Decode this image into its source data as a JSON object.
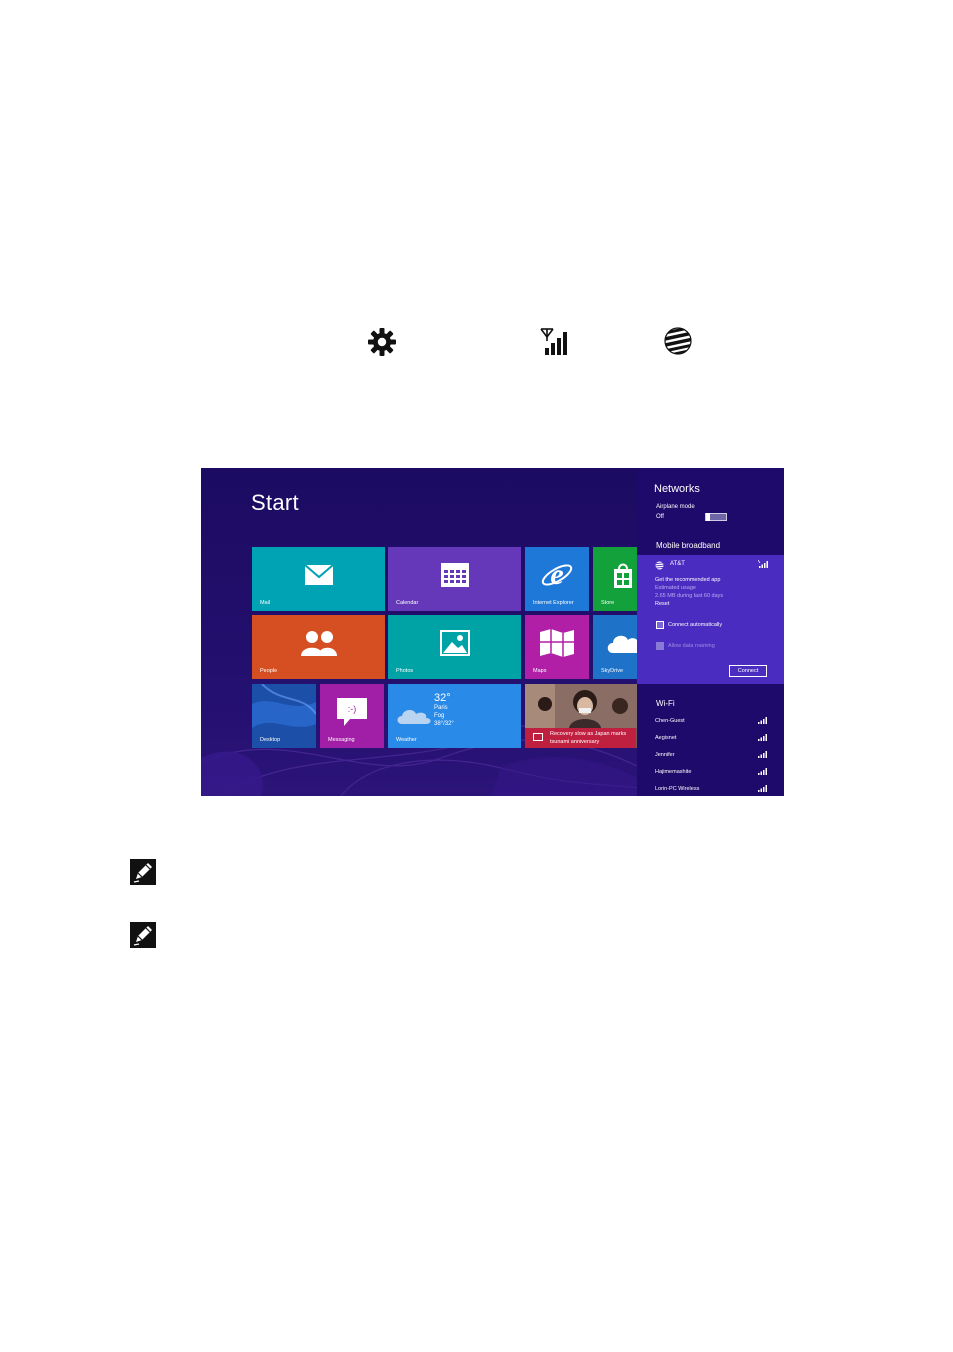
{
  "header_icons": [
    {
      "name": "settings-gear-icon"
    },
    {
      "name": "mobile-broadband-signal-icon"
    },
    {
      "name": "att-globe-icon"
    }
  ],
  "screenshot": {
    "start_title": "Start",
    "tiles": [
      {
        "label": "Mail",
        "color": "#00a3b4"
      },
      {
        "label": "Calendar",
        "color": "#6438b8"
      },
      {
        "label": "Internet Explorer",
        "color": "#1e78d8"
      },
      {
        "label": "Store",
        "color": "#12a13a"
      },
      {
        "label": "People",
        "color": "#d64f23"
      },
      {
        "label": "Photos",
        "color": "#00a3a5"
      },
      {
        "label": "Maps",
        "color": "#b01fa5"
      },
      {
        "label": "SkyDrive",
        "color": "#1e72c8"
      },
      {
        "label": "Desktop",
        "color": "#1c4fa8"
      },
      {
        "label": "Messaging",
        "color": "#a11ea6"
      },
      {
        "label": "Weather",
        "color": "#2a8ae8"
      }
    ],
    "weather": {
      "temp": "32°",
      "city": "Paris",
      "condition": "Fog",
      "range": "38°/32°"
    },
    "news": {
      "line1": "Recovery slow as Japan marks",
      "line2": "tsunami anniversary",
      "color": "#c02040"
    },
    "networks_panel": {
      "title": "Networks",
      "airplane_label": "Airplane mode",
      "airplane_state": "Off",
      "mobile_broadband_label": "Mobile broadband",
      "carrier": "AT&T",
      "recommended_app": "Get the recommended app",
      "estimated_usage_label": "Estimated usage",
      "usage_value": "2.65 MB during last 60 days",
      "reset_label": "Reset",
      "connect_auto_label": "Connect automatically",
      "allow_roaming_label": "Allow data roaming",
      "connect_button": "Connect",
      "wifi_label": "Wi-Fi",
      "wifi_networks": [
        "Chen-Guest",
        "Aegisnet",
        "Jennifer",
        "Hajimemashite",
        "Lorin-PC Wireless"
      ]
    }
  }
}
